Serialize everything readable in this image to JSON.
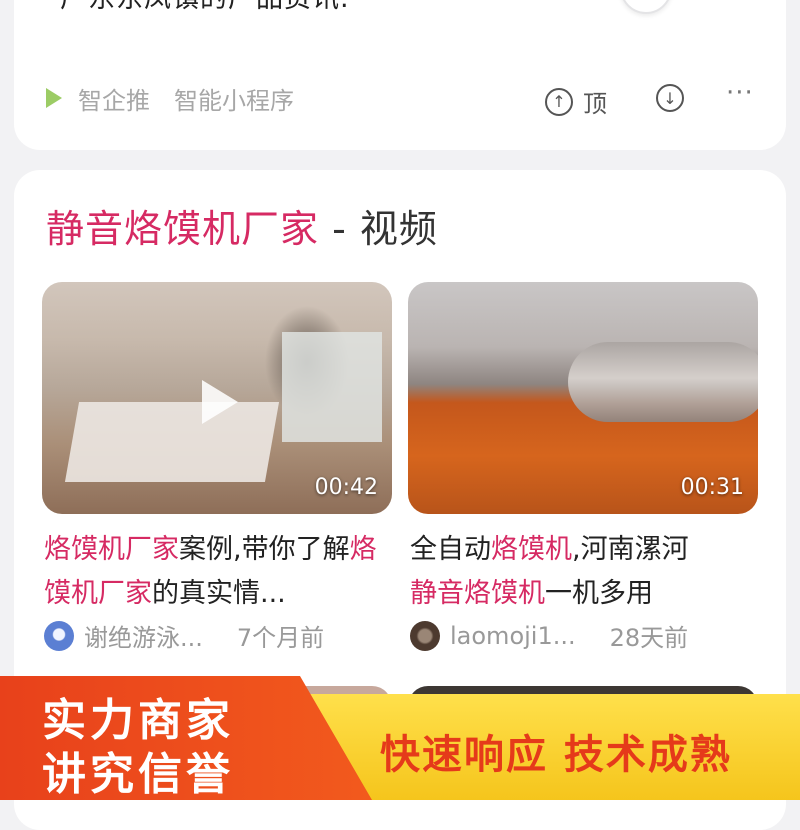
{
  "top_card": {
    "description": "广东东凤镇的产品资讯.",
    "source_name": "智企推",
    "source_type": "智能小程序",
    "upvote_label": "顶"
  },
  "section": {
    "title_highlight": "静音烙馍机厂家",
    "title_rest": " - 视频"
  },
  "videos": [
    {
      "duration": "00:42",
      "title_parts": [
        {
          "text": "烙馍机厂家",
          "hl": true
        },
        {
          "text": "案例,带你了解",
          "hl": false
        },
        {
          "text": "烙馍机厂家",
          "hl": true
        },
        {
          "text": "的真实情...",
          "hl": false
        }
      ],
      "author": "谢绝游泳...",
      "time": "7个月前"
    },
    {
      "duration": "00:31",
      "title_parts": [
        {
          "text": "全自动",
          "hl": false
        },
        {
          "text": "烙馍机",
          "hl": true
        },
        {
          "text": ",河南漯河",
          "hl": false
        },
        {
          "text": "静音烙馍机",
          "hl": true
        },
        {
          "text": "一机多用",
          "hl": false
        }
      ],
      "author": "laomoji1...",
      "time": "28天前"
    }
  ],
  "banner": {
    "left_line1": "实力商家",
    "left_line2": "讲究信誉",
    "right_text": "快速响应 技术成熟"
  },
  "icons": {
    "source": "play-arrow-icon",
    "upvote": "thumb-up-icon",
    "downvote": "thumb-down-icon",
    "more": "more-icon",
    "video_play": "play-icon"
  },
  "colors": {
    "highlight": "#d62a63",
    "banner_left": "#e8411b",
    "banner_right": "#ffe04b",
    "banner_right_text": "#e53a1a"
  }
}
